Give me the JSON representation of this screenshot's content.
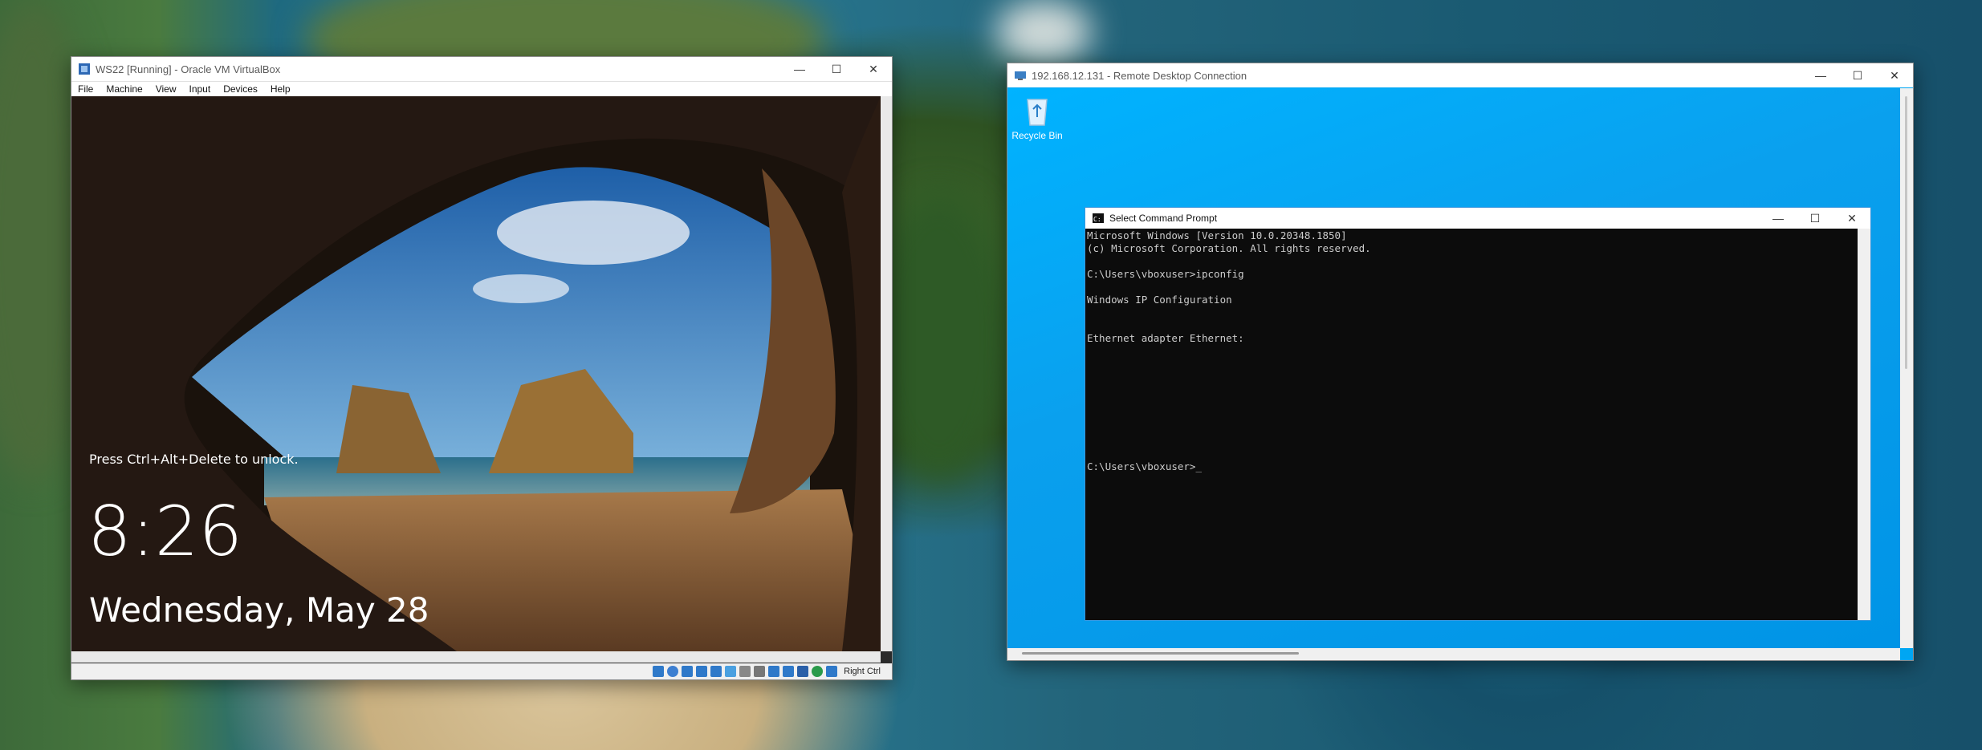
{
  "vbox": {
    "title": "WS22 [Running] - Oracle VM VirtualBox",
    "menu": [
      "File",
      "Machine",
      "View",
      "Input",
      "Devices",
      "Help"
    ],
    "status_hostkey": "Right Ctrl",
    "lock_hint": "Press Ctrl+Alt+Delete to unlock.",
    "time": "8:26",
    "date": "Wednesday, May 28"
  },
  "rdp": {
    "title": "192.168.12.131 - Remote Desktop Connection",
    "recycle_bin_label": "Recycle Bin",
    "cmd": {
      "title": "Select Command Prompt",
      "lines": [
        "Microsoft Windows [Version 10.0.20348.1850]",
        "(c) Microsoft Corporation. All rights reserved.",
        "",
        "C:\\Users\\vboxuser>ipconfig",
        "",
        "Windows IP Configuration",
        "",
        "",
        "Ethernet adapter Ethernet:",
        "",
        "",
        "",
        "",
        "",
        "",
        "",
        "",
        "",
        "C:\\Users\\vboxuser>_"
      ]
    }
  },
  "window_controls": {
    "minimize": "—",
    "maximize": "☐",
    "close": "✕"
  }
}
